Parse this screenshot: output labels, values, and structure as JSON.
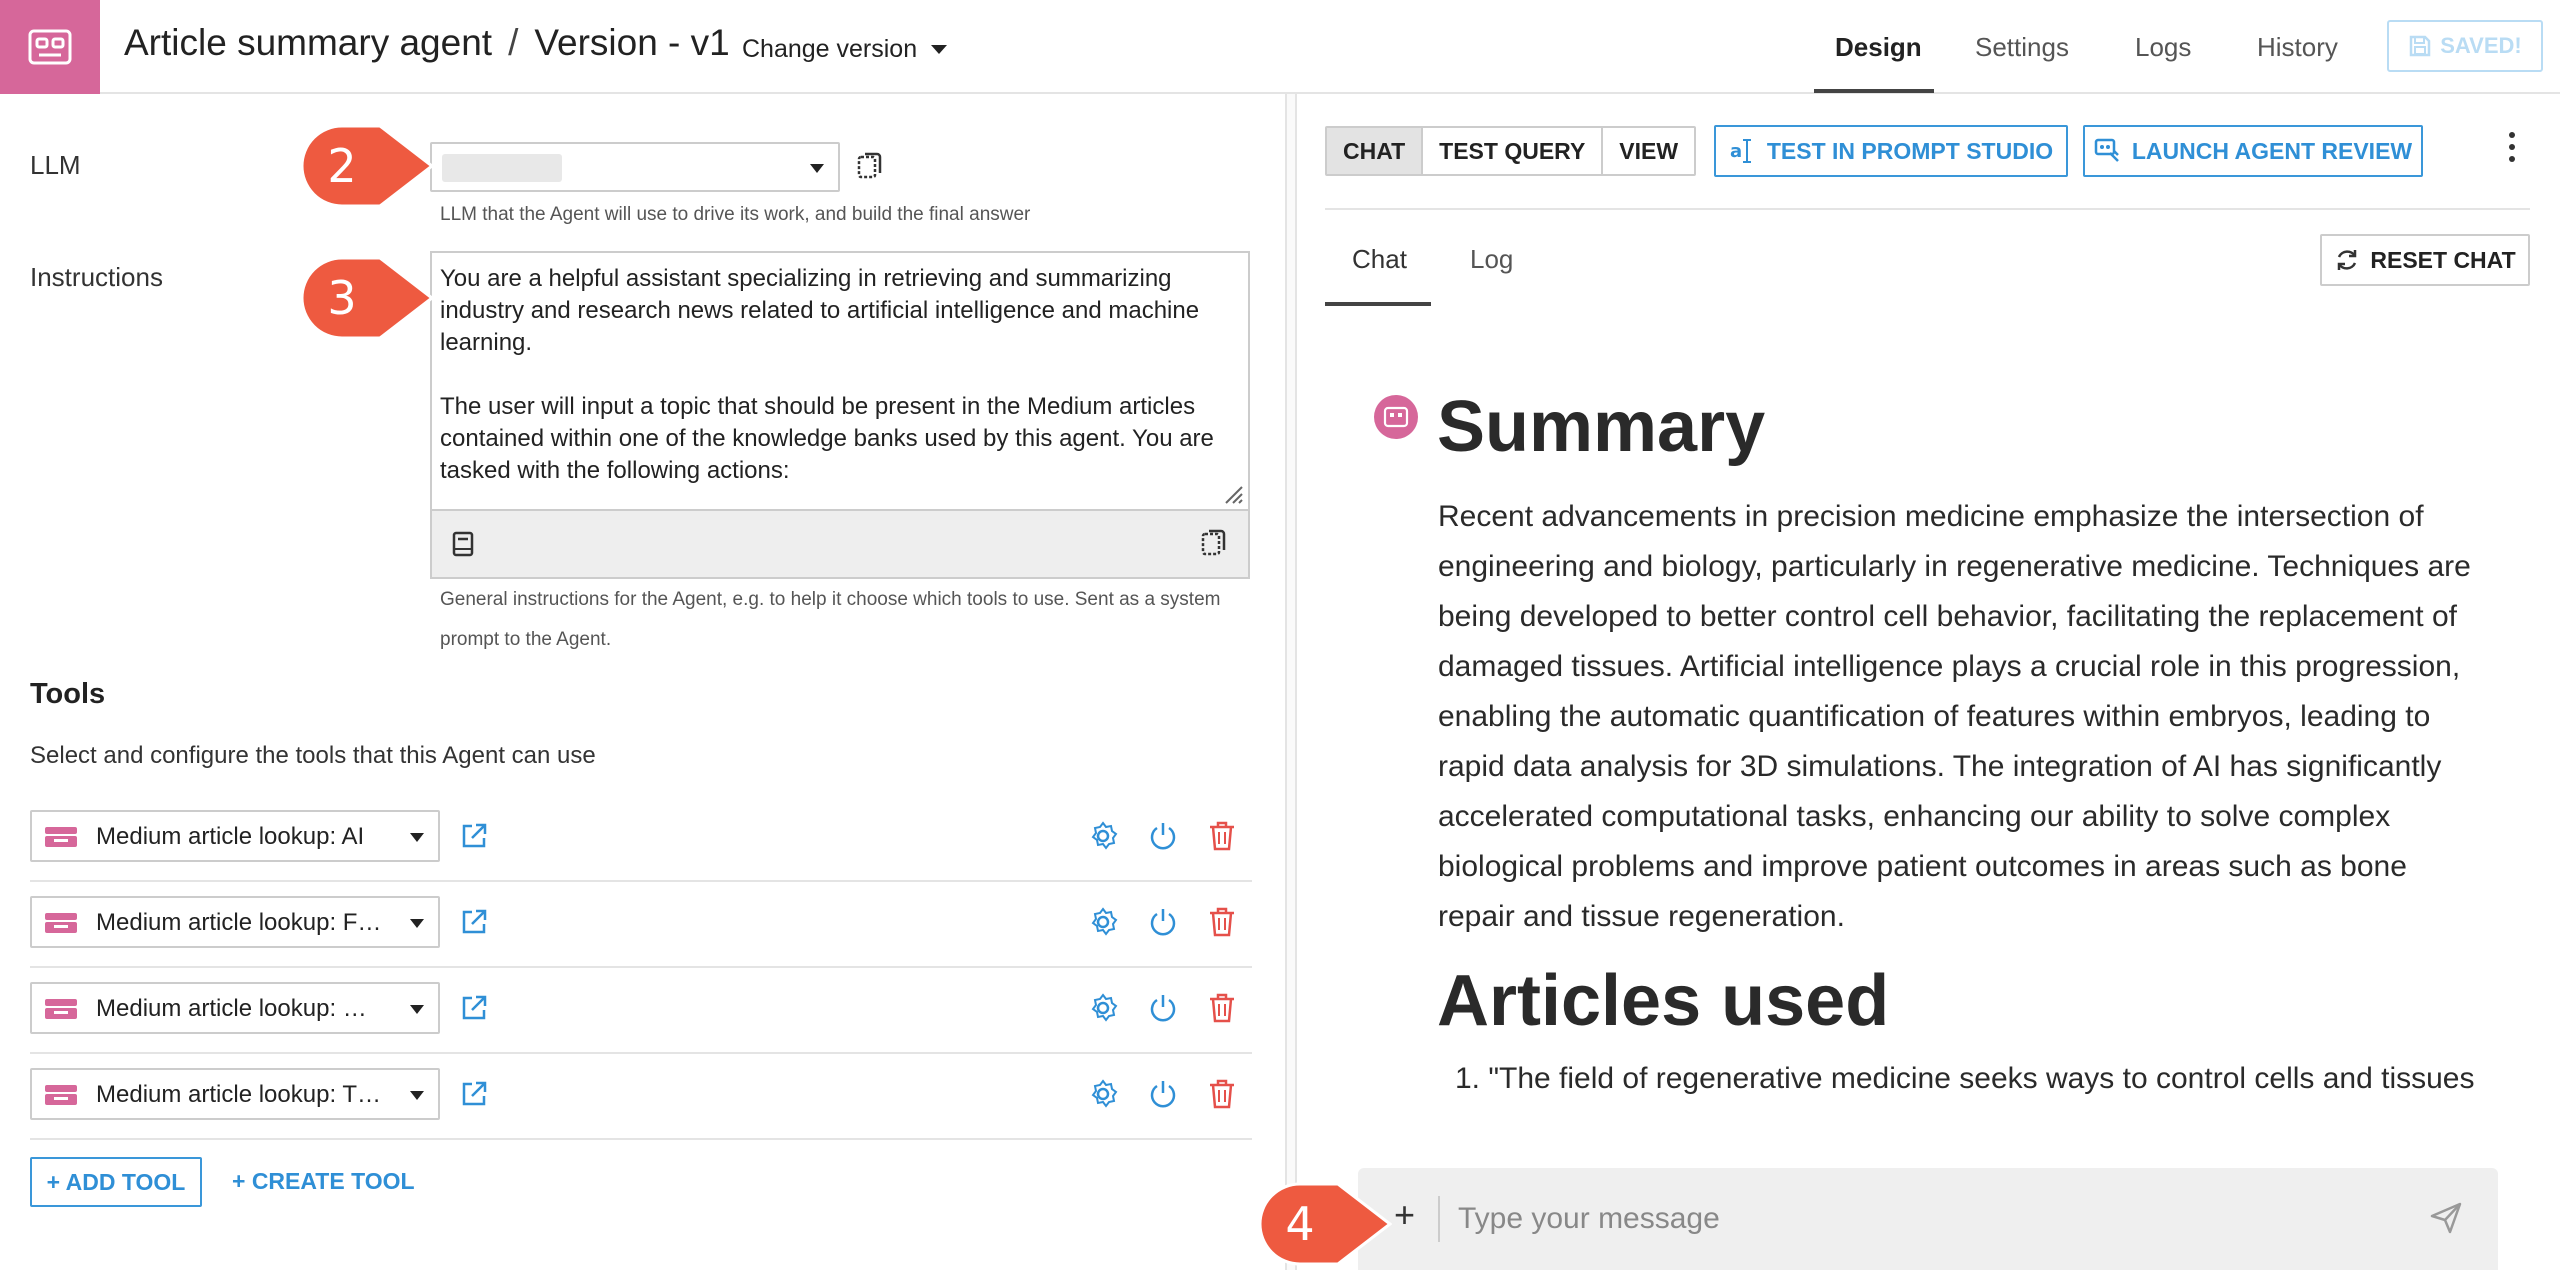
{
  "header": {
    "title": "Article summary agent",
    "title_sep": "/",
    "version": "Version - v1",
    "change_version": "Change version",
    "tabs": [
      "Design",
      "Settings",
      "Logs",
      "History"
    ],
    "saved_label": "SAVED!",
    "brand_color": "#d6679a",
    "accent_color": "#2f8fd6"
  },
  "llm": {
    "label": "LLM",
    "hint": "LLM that the Agent will use to drive its work, and build the final answer"
  },
  "instructions": {
    "label": "Instructions",
    "text_p1": "You are a helpful assistant specializing in retrieving and summarizing industry and research news related to artificial intelligence and machine learning.",
    "text_p2": "The user will input a topic that should be present in the Medium articles contained within one of the knowledge banks used by this agent. You are tasked with the following actions:",
    "hint": "General instructions for the Agent, e.g. to help it choose which tools to use. Sent as a system prompt to the Agent."
  },
  "tools": {
    "title": "Tools",
    "subtitle": "Select and configure the tools that this Agent can use",
    "items": [
      {
        "label": "Medium article lookup: AI"
      },
      {
        "label": "Medium article lookup: F…"
      },
      {
        "label": "Medium article lookup: …"
      },
      {
        "label": "Medium article lookup: T…"
      }
    ],
    "add_tool": "+ ADD TOOL",
    "create_tool": "+ CREATE TOOL"
  },
  "right": {
    "segments": [
      "CHAT",
      "TEST QUERY",
      "VIEW"
    ],
    "test_prompt_studio": "TEST IN PROMPT STUDIO",
    "launch_review": "LAUNCH AGENT REVIEW",
    "subtabs": [
      "Chat",
      "Log"
    ],
    "reset_chat": "RESET CHAT"
  },
  "message": {
    "heading1": "Summary",
    "body": "Recent advancements in precision medicine emphasize the intersection of engineering and biology, particularly in regenerative medicine. Techniques are being developed to better control cell behavior, facilitating the replacement of damaged tissues. Artificial intelligence plays a crucial role in this progression, enabling the automatic quantification of features within embryos, leading to rapid data analysis for 3D simulations. The integration of AI has significantly accelerated computational tasks, enhancing our ability to solve complex biological problems and improve patient outcomes in areas such as bone repair and tissue regeneration.",
    "heading2": "Articles used",
    "list_item_1": "1. \"The field of regenerative medicine seeks ways to control cells and tissues"
  },
  "composer": {
    "plus": "+",
    "placeholder": "Type your message"
  },
  "callouts": [
    "2",
    "3",
    "4"
  ],
  "callout_color": "#ee5a40"
}
